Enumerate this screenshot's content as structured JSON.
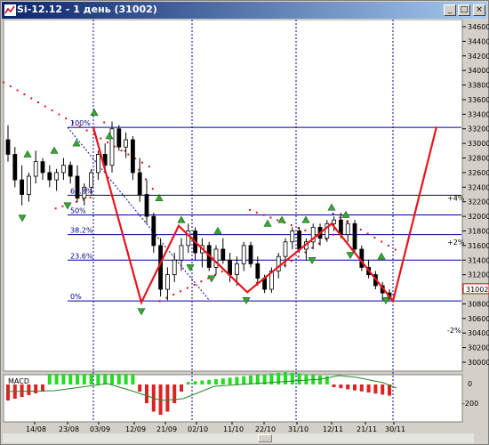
{
  "window": {
    "title": "Si-12.12 - 1 день (31002)"
  },
  "price_axis": {
    "ticks": [
      "34600",
      "34400",
      "34200",
      "34000",
      "33800",
      "33600",
      "33400",
      "33200",
      "33000",
      "32800",
      "32600",
      "32400",
      "32200",
      "32000",
      "31800",
      "31600",
      "31400",
      "31200",
      "31000",
      "30800",
      "30600",
      "30400",
      "30200",
      "30000"
    ],
    "current": "31002"
  },
  "fib_levels": [
    {
      "label": "100%",
      "value": 33220
    },
    {
      "label": "61.8%",
      "value": 32290
    },
    {
      "label": "50%",
      "value": 32020
    },
    {
      "label": "38.2%",
      "value": 31750
    },
    {
      "label": "23.6%",
      "value": 31400
    },
    {
      "label": "0%",
      "value": 30840
    }
  ],
  "right_labels": [
    {
      "text": "+4%",
      "value": 32250,
      "color": "#009900"
    },
    {
      "text": "+2%",
      "value": 31650,
      "color": "#009900"
    },
    {
      "text": "-2%",
      "value": 30440,
      "color": "#cc0000"
    }
  ],
  "date_labels": [
    "14/08",
    "23/08",
    "03/09",
    "12/09",
    "21/09",
    "02/10",
    "11/10",
    "22/10",
    "31/10",
    "12/11",
    "21/11",
    "30/11"
  ],
  "macd": {
    "label": "MACD",
    "ticks": [
      "0",
      "-200"
    ]
  },
  "chart_data": {
    "type": "candlestick",
    "ylim": [
      30000,
      34650
    ],
    "candles": [
      [
        33050,
        33250,
        32750,
        32850
      ],
      [
        32850,
        32950,
        32400,
        32500
      ],
      [
        32500,
        32700,
        32150,
        32300
      ],
      [
        32300,
        32600,
        32200,
        32550
      ],
      [
        32550,
        32900,
        32450,
        32750
      ],
      [
        32750,
        32800,
        32500,
        32600
      ],
      [
        32600,
        32700,
        32400,
        32500
      ],
      [
        32500,
        32650,
        32350,
        32600
      ],
      [
        32600,
        32800,
        32500,
        32700
      ],
      [
        32700,
        32750,
        32450,
        32550
      ],
      [
        32550,
        32700,
        32200,
        32250
      ],
      [
        32250,
        32450,
        32150,
        32400
      ],
      [
        32400,
        32650,
        32300,
        32600
      ],
      [
        32600,
        32900,
        32500,
        32850
      ],
      [
        32850,
        33000,
        32650,
        32700
      ],
      [
        32700,
        33300,
        32600,
        33200
      ],
      [
        33200,
        33250,
        32900,
        32950
      ],
      [
        32950,
        33150,
        32800,
        33050
      ],
      [
        33050,
        33100,
        32500,
        32600
      ],
      [
        32600,
        32800,
        32200,
        32300
      ],
      [
        32300,
        32500,
        31900,
        32000
      ],
      [
        32000,
        32050,
        31500,
        31600
      ],
      [
        31600,
        31700,
        30900,
        31000
      ],
      [
        31000,
        31300,
        30850,
        31200
      ],
      [
        31200,
        31500,
        31100,
        31400
      ],
      [
        31400,
        31700,
        31250,
        31600
      ],
      [
        31600,
        31900,
        31500,
        31800
      ],
      [
        31800,
        31850,
        31400,
        31500
      ],
      [
        31500,
        31700,
        31300,
        31600
      ],
      [
        31600,
        31650,
        31250,
        31300
      ],
      [
        31300,
        31600,
        31200,
        31550
      ],
      [
        31550,
        31700,
        31350,
        31400
      ],
      [
        31400,
        31500,
        31100,
        31200
      ],
      [
        31200,
        31450,
        31050,
        31350
      ],
      [
        31350,
        31650,
        31250,
        31600
      ],
      [
        31600,
        31650,
        31300,
        31350
      ],
      [
        31350,
        31450,
        31050,
        31150
      ],
      [
        31150,
        31200,
        30950,
        31000
      ],
      [
        31000,
        31300,
        30950,
        31250
      ],
      [
        31250,
        31500,
        31150,
        31450
      ],
      [
        31450,
        31700,
        31300,
        31650
      ],
      [
        31650,
        31850,
        31550,
        31800
      ],
      [
        31800,
        31850,
        31500,
        31550
      ],
      [
        31550,
        31700,
        31400,
        31650
      ],
      [
        31650,
        31900,
        31550,
        31850
      ],
      [
        31850,
        31900,
        31600,
        31700
      ],
      [
        31700,
        31950,
        31650,
        31900
      ],
      [
        31900,
        32000,
        31800,
        31950
      ],
      [
        31950,
        32050,
        31700,
        31750
      ],
      [
        31750,
        31950,
        31650,
        31900
      ],
      [
        31900,
        31950,
        31500,
        31550
      ],
      [
        31550,
        31600,
        31250,
        31300
      ],
      [
        31300,
        31400,
        31150,
        31200
      ],
      [
        31200,
        31250,
        31000,
        31050
      ],
      [
        31050,
        31100,
        30850,
        30950
      ],
      [
        30950,
        31000,
        30850,
        30900
      ]
    ]
  },
  "colors": {
    "plot_bg": "#ffffff",
    "grid": "#0000a0",
    "zigzag": "#e8141e",
    "sar": "#dd1111",
    "arrow": "#33aa33"
  }
}
